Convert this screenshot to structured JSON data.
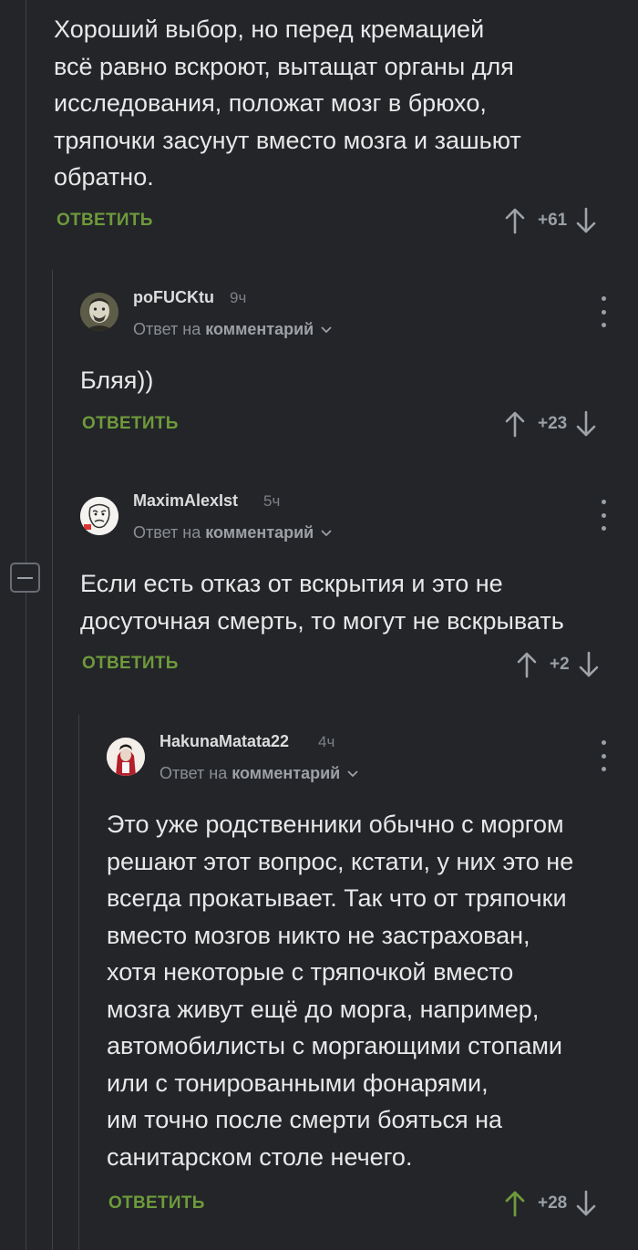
{
  "comments": [
    {
      "text": "Хороший выбор, но перед кремацией\nвсё равно вскроют, вытащат органы для\nисследования, положат мозг в брюхо,\nтряпочки засунут вместо мозга и зашьют\nобратно.",
      "reply_label": "ОТВЕТИТЬ",
      "votes": "+61"
    },
    {
      "author": "poFUCKtu",
      "time": "9ч",
      "reply_to_prefix": "Ответ на",
      "reply_to_target": "комментарий",
      "text": "Бляя))",
      "reply_label": "ОТВЕТИТЬ",
      "votes": "+23"
    },
    {
      "author": "MaximAlexIst",
      "time": "5ч",
      "reply_to_prefix": "Ответ на",
      "reply_to_target": "комментарий",
      "text": "Если есть отказ от вскрытия и это не\nдосуточная смерть, то могут не вскрывать",
      "reply_label": "ОТВЕТИТЬ",
      "votes": "+2"
    },
    {
      "author": "HakunaMatata22",
      "time": "4ч",
      "reply_to_prefix": "Ответ на",
      "reply_to_target": "комментарий",
      "text": "Это уже родственники обычно с моргом\nрешают этот вопрос, кстати, у них это не\nвсегда прокатывает. Так что от тряпочки\nвместо мозгов никто не застрахован,\nхотя некоторые с тряпочкой вместо\nмозга живут ещё до морга, например,\nавтомобилисты с моргающими стопами\nили с тонированными фонарями,\nим точно после смерти бояться на\nсанитарском столе нечего.",
      "reply_label": "ОТВЕТИТЬ",
      "votes": "+28",
      "upvoted": true
    }
  ],
  "colors": {
    "background": "#232529",
    "accent_green": "#6e9a3b",
    "muted": "#9aa0a6"
  }
}
